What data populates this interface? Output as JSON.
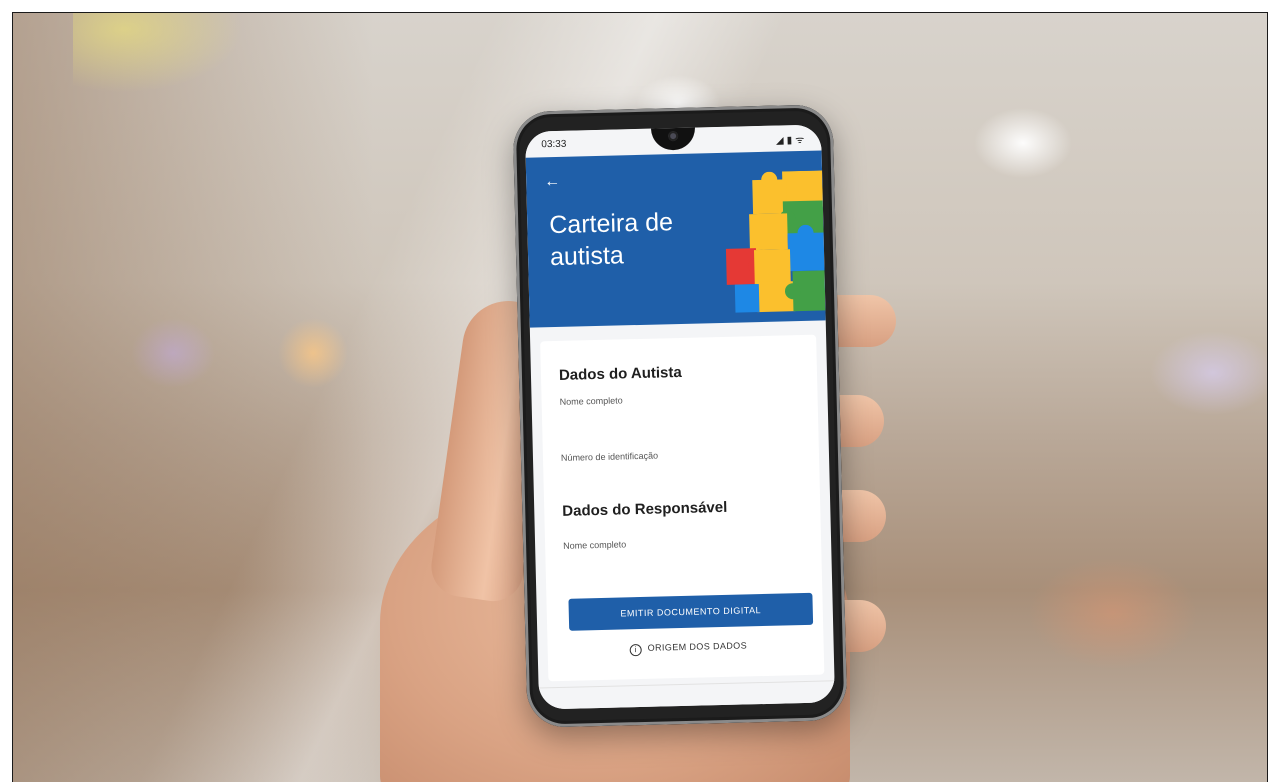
{
  "status_bar": {
    "time": "03:33",
    "icons": [
      "signal-icon",
      "battery-icon",
      "wifi-icon"
    ]
  },
  "header": {
    "title": "Carteira de autista",
    "back_icon": "arrow-left-icon",
    "background_color": "#1f5fa9"
  },
  "form": {
    "autista_section_title": "Dados do Autista",
    "autista_name_label": "Nome completo",
    "autista_id_label": "Número de identificação",
    "responsavel_section_title": "Dados do Responsável",
    "responsavel_name_label": "Nome completo"
  },
  "actions": {
    "emit_button_label": "EMITIR DOCUMENTO DIGITAL",
    "origin_link_label": "ORIGEM DOS DADOS",
    "origin_icon": "info-icon"
  },
  "colors": {
    "accent": "#1f5fa9",
    "puzzle": [
      "#e53935",
      "#fbc02d",
      "#43a047",
      "#1e88e5"
    ]
  }
}
